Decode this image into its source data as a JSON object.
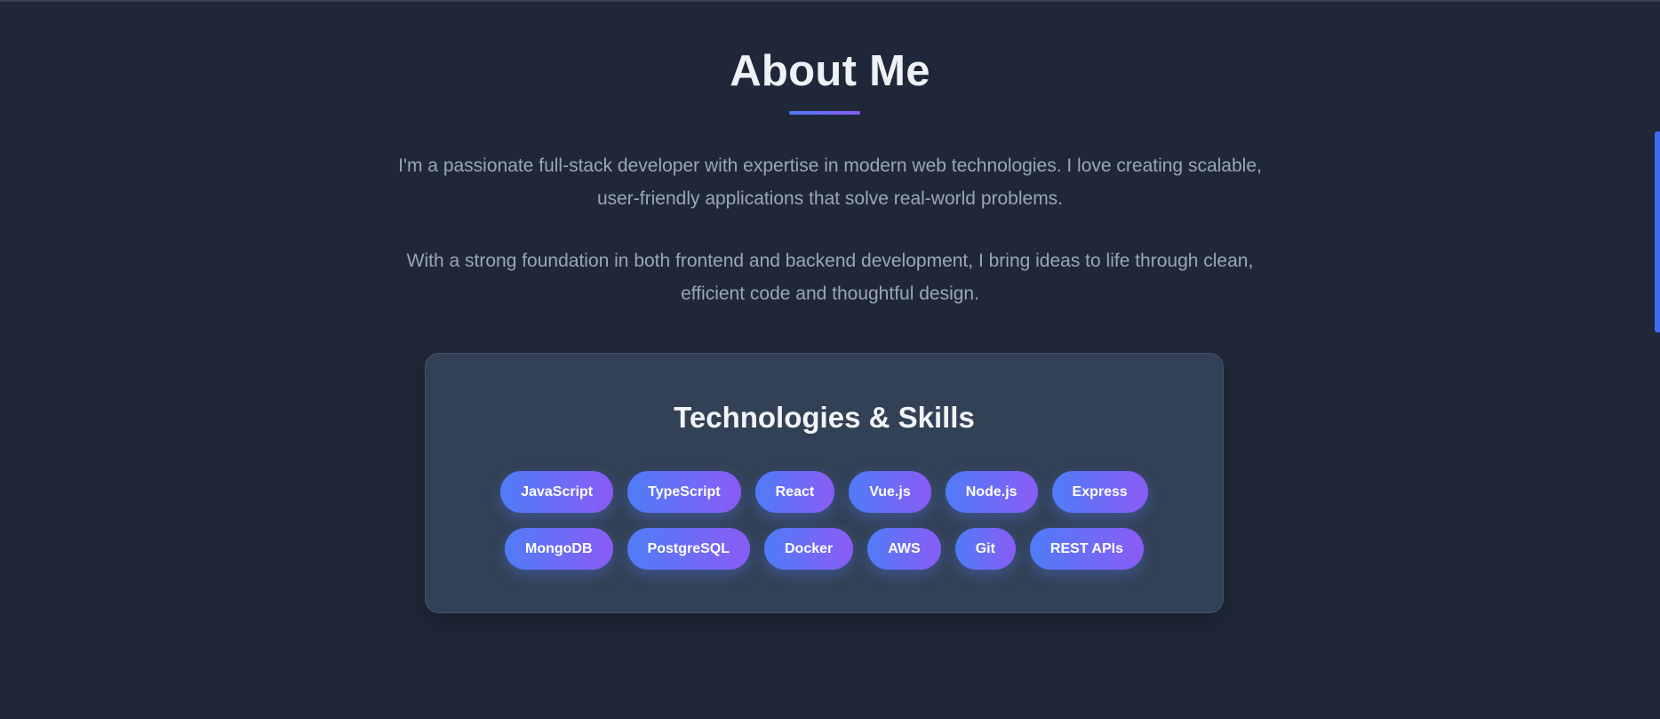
{
  "about": {
    "title": "About Me",
    "paragraphs": [
      "I'm a passionate full-stack developer with expertise in modern web technologies. I love creating scalable, user-friendly applications that solve real-world problems.",
      "With a strong foundation in both frontend and backend development, I bring ideas to life through clean, efficient code and thoughtful design."
    ]
  },
  "skills_card": {
    "title": "Technologies & Skills",
    "rows": [
      [
        "JavaScript",
        "TypeScript",
        "React",
        "Vue.js",
        "Node.js",
        "Express"
      ],
      [
        "MongoDB",
        "PostgreSQL",
        "Docker",
        "AWS",
        "Git",
        "REST APIs"
      ]
    ]
  },
  "colors": {
    "background": "#1f2839",
    "card": "#334156",
    "accent_start": "#4f7cf7",
    "accent_end": "#8a5cf6",
    "scroll_indicator": "#3b6ff0"
  }
}
